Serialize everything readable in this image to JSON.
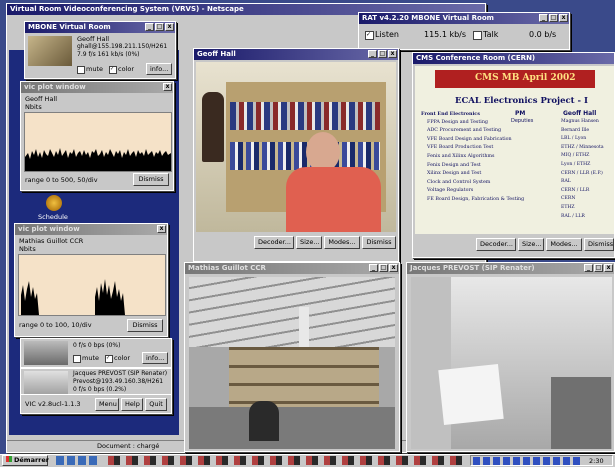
{
  "browser": {
    "title": "Virtual Room Videoconferencing System (VRVS) - Netscape",
    "status": "Document : chargé"
  },
  "rat": {
    "title": "RAT v4.2.20 MBONE Virtual Room",
    "listen_label": "Listen",
    "listen_rate": "115.1 kb/s",
    "talk_label": "Talk",
    "talk_rate": "0.0 b/s"
  },
  "participant1": {
    "title": "MBONE Virtual Room",
    "name": "Geoff Hall",
    "addr": "ghall@155.198.211.150/H261",
    "stats": "7.9 f/s  161 kb/s  (0%)",
    "mute_label": "mute",
    "color_label": "color",
    "info_label": "info..."
  },
  "plot1": {
    "title": "vic plot window",
    "name": "Geoff Hall",
    "sub": "Nbits",
    "range": "range 0 to 500, 50/div",
    "dismiss": "Dismiss"
  },
  "plot2": {
    "title": "vic plot window",
    "name": "Mathias Guillot CCR",
    "sub": "Nbits",
    "range": "range 0 to 100, 10/div",
    "dismiss": "Dismiss"
  },
  "participant2": {
    "stats": "0 f/s  0 bps  (0%)",
    "mute_label": "mute",
    "color_label": "color",
    "info_label": "info..."
  },
  "participant3": {
    "name": "Jacques PREVOST (SIP Renater)",
    "addr": "Prevost@193.49.160.38/H261",
    "stats": "0 f/s  0 bps  (0.2%)",
    "mute_label": "mute",
    "color_label": "color",
    "info_label": "info..."
  },
  "vicmain": {
    "version": "VIC v2.8ucl-1.1.3",
    "menu": "Menu",
    "help": "Help",
    "quit": "Quit"
  },
  "video_geoff": {
    "title": "Geoff Hall",
    "buttons": [
      "Decoder...",
      "Size...",
      "Modes...",
      "Dismiss"
    ]
  },
  "video_cms": {
    "title": "CMS Conference Room (CERN)",
    "slide_title": "CMS MB April 2002",
    "project": "ECAL Electronics Project - I",
    "col_pm": "PM",
    "col_deputies": "Deputies",
    "col_lead": "Geoff Hall",
    "rows": [
      "Front End Electronics",
      "FPPA Design and Testing",
      "ADC Procurement and Testing",
      "VFE Board Design and Fabrication",
      "VFE Board Production Test",
      "Fenix and Xilinx Algorithms",
      "Fenix Design and Test",
      "Xilinx Design and Test",
      "Clock and Control System",
      "Voltage Regulators",
      "FE Board Design, Fabrication & Testing"
    ],
    "right_col": [
      "Magnus Hansen",
      "Bernard Ille",
      "LBL / Lyon",
      "ETHZ / Minnesota",
      "MIQ / ETHZ",
      "Lyon / ETHZ",
      "CERN / LLR (E.P.)",
      "RAL",
      "CERN / LLR",
      "CERN",
      "ETHZ",
      "RAL / LLR"
    ],
    "buttons": [
      "Decoder...",
      "Size...",
      "Modes...",
      "Dismiss"
    ]
  },
  "video_mathias": {
    "title": "Mathias Guillot CCR"
  },
  "video_jacques": {
    "title": "Jacques PREVOST (SIP Renater)"
  },
  "desktop": {
    "schedule_label": "Schedule"
  },
  "taskbar": {
    "start": "Démarrer",
    "clock": "2:30"
  },
  "colors": {
    "desktop": "#3a4a8a",
    "titlebar": "#1a1a6a",
    "window": "#c8c8c8",
    "slide_bg": "#f0f0e0",
    "slide_title_bg": "#b02020",
    "plot_bg": "#f5e2c8"
  }
}
